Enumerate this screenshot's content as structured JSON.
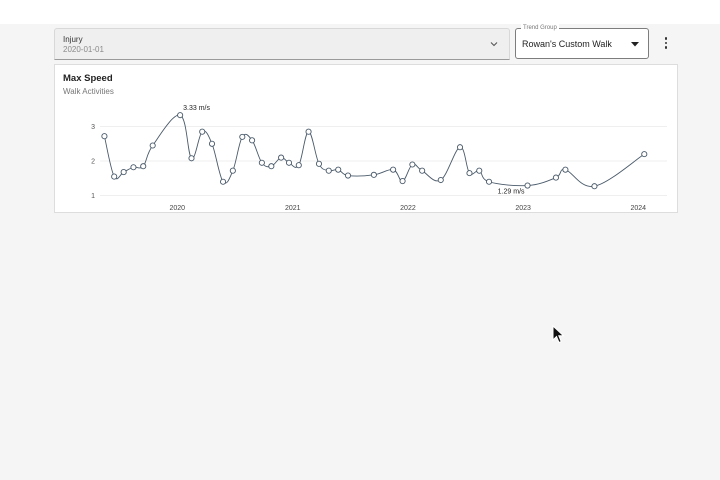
{
  "filters": {
    "injury": {
      "label": "Injury",
      "value": "2020-01-01",
      "icon": "chevron-down-icon"
    },
    "trend_group": {
      "legend": "Trend Group",
      "value": "Rowan's Custom Walk",
      "icon": "caret-down-icon"
    },
    "menu_icon": "kebab-menu-icon"
  },
  "card": {
    "title": "Max Speed",
    "subtitle": "Walk Activities"
  },
  "chart_data": {
    "type": "line",
    "title": "Max Speed",
    "subtitle": "Walk Activities",
    "x_ticks": [
      "2020",
      "2021",
      "2022",
      "2023",
      "2024"
    ],
    "y_ticks": [
      1,
      2,
      3
    ],
    "ylim": [
      0.9,
      3.45
    ],
    "xlim": [
      "2019-05-01",
      "2024-04-01"
    ],
    "grid": "horizontal",
    "line_color": "#4a5a6a",
    "series": [
      {
        "points": [
          [
            "2019-05-15",
            2.72
          ],
          [
            "2019-06-15",
            1.55
          ],
          [
            "2019-07-15",
            1.68
          ],
          [
            "2019-08-15",
            1.82
          ],
          [
            "2019-09-15",
            1.85
          ],
          [
            "2019-10-15",
            2.45
          ],
          [
            "2020-01-10",
            3.33
          ],
          [
            "2020-02-15",
            2.08
          ],
          [
            "2020-03-20",
            2.85
          ],
          [
            "2020-04-20",
            2.5
          ],
          [
            "2020-05-25",
            1.4
          ],
          [
            "2020-06-25",
            1.72
          ],
          [
            "2020-07-25",
            2.7
          ],
          [
            "2020-08-25",
            2.6
          ],
          [
            "2020-09-25",
            1.95
          ],
          [
            "2020-10-25",
            1.85
          ],
          [
            "2020-11-25",
            2.1
          ],
          [
            "2020-12-20",
            1.95
          ],
          [
            "2021-01-20",
            1.88
          ],
          [
            "2021-02-20",
            2.85
          ],
          [
            "2021-03-25",
            1.92
          ],
          [
            "2021-04-25",
            1.72
          ],
          [
            "2021-05-25",
            1.75
          ],
          [
            "2021-06-25",
            1.58
          ],
          [
            "2021-09-15",
            1.6
          ],
          [
            "2021-11-15",
            1.75
          ],
          [
            "2021-12-15",
            1.42
          ],
          [
            "2022-01-15",
            1.9
          ],
          [
            "2022-02-15",
            1.72
          ],
          [
            "2022-04-15",
            1.45
          ],
          [
            "2022-06-15",
            2.4
          ],
          [
            "2022-07-15",
            1.65
          ],
          [
            "2022-08-15",
            1.72
          ],
          [
            "2022-09-15",
            1.4
          ],
          [
            "2023-01-15",
            1.29
          ],
          [
            "2023-04-15",
            1.52
          ],
          [
            "2023-05-15",
            1.75
          ],
          [
            "2023-08-15",
            1.27
          ],
          [
            "2024-01-20",
            2.2
          ]
        ]
      }
    ],
    "annotations": [
      {
        "label": "3.33 m/s",
        "x": "2020-01-10",
        "y": 3.33,
        "position": "above"
      },
      {
        "label": "1.29 m/s",
        "x": "2023-01-15",
        "y": 1.29,
        "position": "left-above"
      }
    ]
  }
}
